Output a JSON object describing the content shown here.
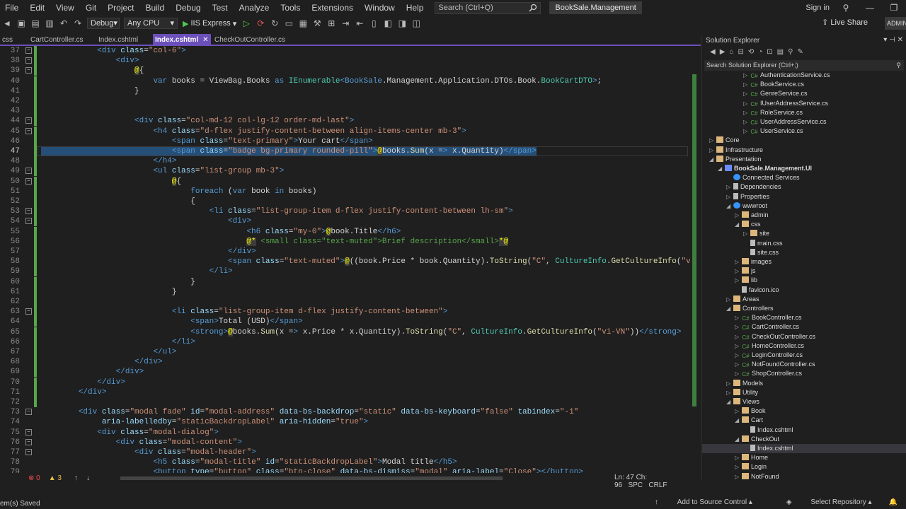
{
  "menu": [
    "File",
    "Edit",
    "View",
    "Git",
    "Project",
    "Build",
    "Debug",
    "Test",
    "Analyze",
    "Tools",
    "Extensions",
    "Window",
    "Help"
  ],
  "search": {
    "placeholder": "Search (Ctrl+Q)"
  },
  "solution_name": "BookSale.Management",
  "signin": "Sign in",
  "toolbar": {
    "config": "Debug",
    "platform": "Any CPU",
    "run_target": "IIS Express",
    "live_share": "Live Share",
    "admin": "ADMIN"
  },
  "tabs": [
    {
      "label": "css"
    },
    {
      "label": "CartController.cs"
    },
    {
      "label": "Index.cshtml"
    },
    {
      "label": "Index.cshtml",
      "active": true
    },
    {
      "label": "CheckOutController.cs"
    }
  ],
  "code_lines": [
    {
      "n": "37",
      "t": "            <div class=\"col-6\">"
    },
    {
      "n": "38",
      "t": "                <div>"
    },
    {
      "n": "39",
      "t": "                    @{"
    },
    {
      "n": "40",
      "t": "                        var books = ViewBag.Books as IEnumerable<BookSale.Management.Application.DTOs.Book.BookCartDTO>;"
    },
    {
      "n": "41",
      "t": "                    }"
    },
    {
      "n": "42",
      "t": ""
    },
    {
      "n": "43",
      "t": ""
    },
    {
      "n": "44",
      "t": "                    <div class=\"col-md-12 col-lg-12 order-md-last\">"
    },
    {
      "n": "45",
      "t": "                        <h4 class=\"d-flex justify-content-between align-items-center mb-3\">"
    },
    {
      "n": "46",
      "t": "                            <span class=\"text-primary\">Your cart</span>"
    },
    {
      "n": "47",
      "t": "                            <span class=\"badge bg-primary rounded-pill\">@books.Sum(x => x.Quantity)</span>"
    },
    {
      "n": "48",
      "t": "                        </h4>"
    },
    {
      "n": "49",
      "t": "                        <ul class=\"list-group mb-3\">"
    },
    {
      "n": "50",
      "t": "                            @{"
    },
    {
      "n": "51",
      "t": "                                foreach (var book in books)"
    },
    {
      "n": "52",
      "t": "                                {"
    },
    {
      "n": "53",
      "t": "                                    <li class=\"list-group-item d-flex justify-content-between lh-sm\">"
    },
    {
      "n": "54",
      "t": "                                        <div>"
    },
    {
      "n": "55",
      "t": "                                            <h6 class=\"my-0\">@book.Title</h6>"
    },
    {
      "n": "56",
      "t": "                                            @* <small class=\"text-muted\">Brief description</small>*@"
    },
    {
      "n": "57",
      "t": "                                        </div>"
    },
    {
      "n": "58",
      "t": "                                        <span class=\"text-muted\">@((book.Price * book.Quantity).ToString(\"C\", CultureInfo.GetCultureInfo(\"vi-VN\")))</span>"
    },
    {
      "n": "59",
      "t": "                                    </li>"
    },
    {
      "n": "60",
      "t": "                                }"
    },
    {
      "n": "61",
      "t": "                            }"
    },
    {
      "n": "62",
      "t": ""
    },
    {
      "n": "63",
      "t": "                            <li class=\"list-group-item d-flex justify-content-between\">"
    },
    {
      "n": "64",
      "t": "                                <span>Total (USD)</span>"
    },
    {
      "n": "65",
      "t": "                                <strong>@books.Sum(x => x.Price * x.Quantity).ToString(\"C\", CultureInfo.GetCultureInfo(\"vi-VN\"))</strong>"
    },
    {
      "n": "66",
      "t": "                            </li>"
    },
    {
      "n": "67",
      "t": "                        </ul>"
    },
    {
      "n": "68",
      "t": "                    </div>"
    },
    {
      "n": "69",
      "t": "                </div>"
    },
    {
      "n": "70",
      "t": "            </div>"
    },
    {
      "n": "71",
      "t": "        </div>"
    },
    {
      "n": "72",
      "t": ""
    },
    {
      "n": "73",
      "t": "        <div class=\"modal fade\" id=\"modal-address\" data-bs-backdrop=\"static\" data-bs-keyboard=\"false\" tabindex=\"-1\""
    },
    {
      "n": "74",
      "t": "             aria-labelledby=\"staticBackdropLabel\" aria-hidden=\"true\">"
    },
    {
      "n": "75",
      "t": "            <div class=\"modal-dialog\">"
    },
    {
      "n": "76",
      "t": "                <div class=\"modal-content\">"
    },
    {
      "n": "77",
      "t": "                    <div class=\"modal-header\">"
    },
    {
      "n": "78",
      "t": "                        <h5 class=\"modal-title\" id=\"staticBackdropLabel\">Modal title</h5>"
    },
    {
      "n": "79",
      "t": "                        <button type=\"button\" class=\"btn-close\" data-bs-dismiss=\"modal\" aria-label=\"Close\"></button>"
    }
  ],
  "current_line": "47",
  "editor_status": {
    "errors": "0",
    "warnings": "3",
    "position": "Ln: 47   Ch: 96",
    "encoding": "SPC",
    "line_ending": "CRLF"
  },
  "statusbar": {
    "left": "em(s) Saved",
    "add_source": "Add to Source Control",
    "select_repo": "Select Repository"
  },
  "solution_explorer": {
    "title": "Solution Explorer",
    "search_placeholder": "Search Solution Explorer (Ctrl+;)",
    "items": [
      {
        "label": "AuthenticationService.cs",
        "depth": 4,
        "icon": "cs",
        "twisty": "▷"
      },
      {
        "label": "BookService.cs",
        "depth": 4,
        "icon": "cs",
        "twisty": "▷"
      },
      {
        "label": "GenreService.cs",
        "depth": 4,
        "icon": "cs",
        "twisty": "▷"
      },
      {
        "label": "IUserAddressService.cs",
        "depth": 4,
        "icon": "cs",
        "twisty": "▷"
      },
      {
        "label": "RoleService.cs",
        "depth": 4,
        "icon": "cs",
        "twisty": "▷"
      },
      {
        "label": "UserAddressService.cs",
        "depth": 4,
        "icon": "cs",
        "twisty": "▷"
      },
      {
        "label": "UserService.cs",
        "depth": 4,
        "icon": "cs",
        "twisty": "▷"
      },
      {
        "label": "Core",
        "depth": 0,
        "icon": "folder",
        "twisty": "▷"
      },
      {
        "label": "Infrastructure",
        "depth": 0,
        "icon": "folder",
        "twisty": "▷"
      },
      {
        "label": "Presentation",
        "depth": 0,
        "icon": "folder",
        "twisty": "◢"
      },
      {
        "label": "BookSale.Management.UI",
        "depth": 1,
        "icon": "proj",
        "twisty": "◢",
        "bold": true
      },
      {
        "label": "Connected Services",
        "depth": 2,
        "icon": "web",
        "twisty": ""
      },
      {
        "label": "Dependencies",
        "depth": 2,
        "icon": "file",
        "twisty": "▷"
      },
      {
        "label": "Properties",
        "depth": 2,
        "icon": "file",
        "twisty": "▷"
      },
      {
        "label": "wwwroot",
        "depth": 2,
        "icon": "web",
        "twisty": "◢"
      },
      {
        "label": "admin",
        "depth": 3,
        "icon": "folder",
        "twisty": "▷"
      },
      {
        "label": "css",
        "depth": 3,
        "icon": "folder",
        "twisty": "◢"
      },
      {
        "label": "site",
        "depth": 4,
        "icon": "folder",
        "twisty": "▷"
      },
      {
        "label": "main.css",
        "depth": 4,
        "icon": "file",
        "twisty": ""
      },
      {
        "label": "site.css",
        "depth": 4,
        "icon": "file",
        "twisty": ""
      },
      {
        "label": "images",
        "depth": 3,
        "icon": "folder",
        "twisty": "▷"
      },
      {
        "label": "js",
        "depth": 3,
        "icon": "folder",
        "twisty": "▷"
      },
      {
        "label": "lib",
        "depth": 3,
        "icon": "folder",
        "twisty": "▷"
      },
      {
        "label": "favicon.ico",
        "depth": 3,
        "icon": "file",
        "twisty": ""
      },
      {
        "label": "Areas",
        "depth": 2,
        "icon": "folder",
        "twisty": "▷"
      },
      {
        "label": "Controllers",
        "depth": 2,
        "icon": "folder",
        "twisty": "◢"
      },
      {
        "label": "BookController.cs",
        "depth": 3,
        "icon": "cs",
        "twisty": "▷"
      },
      {
        "label": "CartController.cs",
        "depth": 3,
        "icon": "cs",
        "twisty": "▷"
      },
      {
        "label": "CheckOutController.cs",
        "depth": 3,
        "icon": "cs",
        "twisty": "▷"
      },
      {
        "label": "HomeController.cs",
        "depth": 3,
        "icon": "cs",
        "twisty": "▷"
      },
      {
        "label": "LoginController.cs",
        "depth": 3,
        "icon": "cs",
        "twisty": "▷"
      },
      {
        "label": "NotFoundController.cs",
        "depth": 3,
        "icon": "cs",
        "twisty": "▷"
      },
      {
        "label": "ShopController.cs",
        "depth": 3,
        "icon": "cs",
        "twisty": "▷"
      },
      {
        "label": "Models",
        "depth": 2,
        "icon": "folder",
        "twisty": "▷"
      },
      {
        "label": "Utility",
        "depth": 2,
        "icon": "folder",
        "twisty": "▷"
      },
      {
        "label": "Views",
        "depth": 2,
        "icon": "folder",
        "twisty": "◢"
      },
      {
        "label": "Book",
        "depth": 3,
        "icon": "folder",
        "twisty": "▷"
      },
      {
        "label": "Cart",
        "depth": 3,
        "icon": "folder",
        "twisty": "◢"
      },
      {
        "label": "Index.cshtml",
        "depth": 4,
        "icon": "file",
        "twisty": ""
      },
      {
        "label": "CheckOut",
        "depth": 3,
        "icon": "folder",
        "twisty": "◢"
      },
      {
        "label": "Index.cshtml",
        "depth": 4,
        "icon": "file",
        "twisty": "",
        "selected": true
      },
      {
        "label": "Home",
        "depth": 3,
        "icon": "folder",
        "twisty": "▷"
      },
      {
        "label": "Login",
        "depth": 3,
        "icon": "folder",
        "twisty": "▷"
      },
      {
        "label": "NotFound",
        "depth": 3,
        "icon": "folder",
        "twisty": "▷"
      }
    ]
  }
}
